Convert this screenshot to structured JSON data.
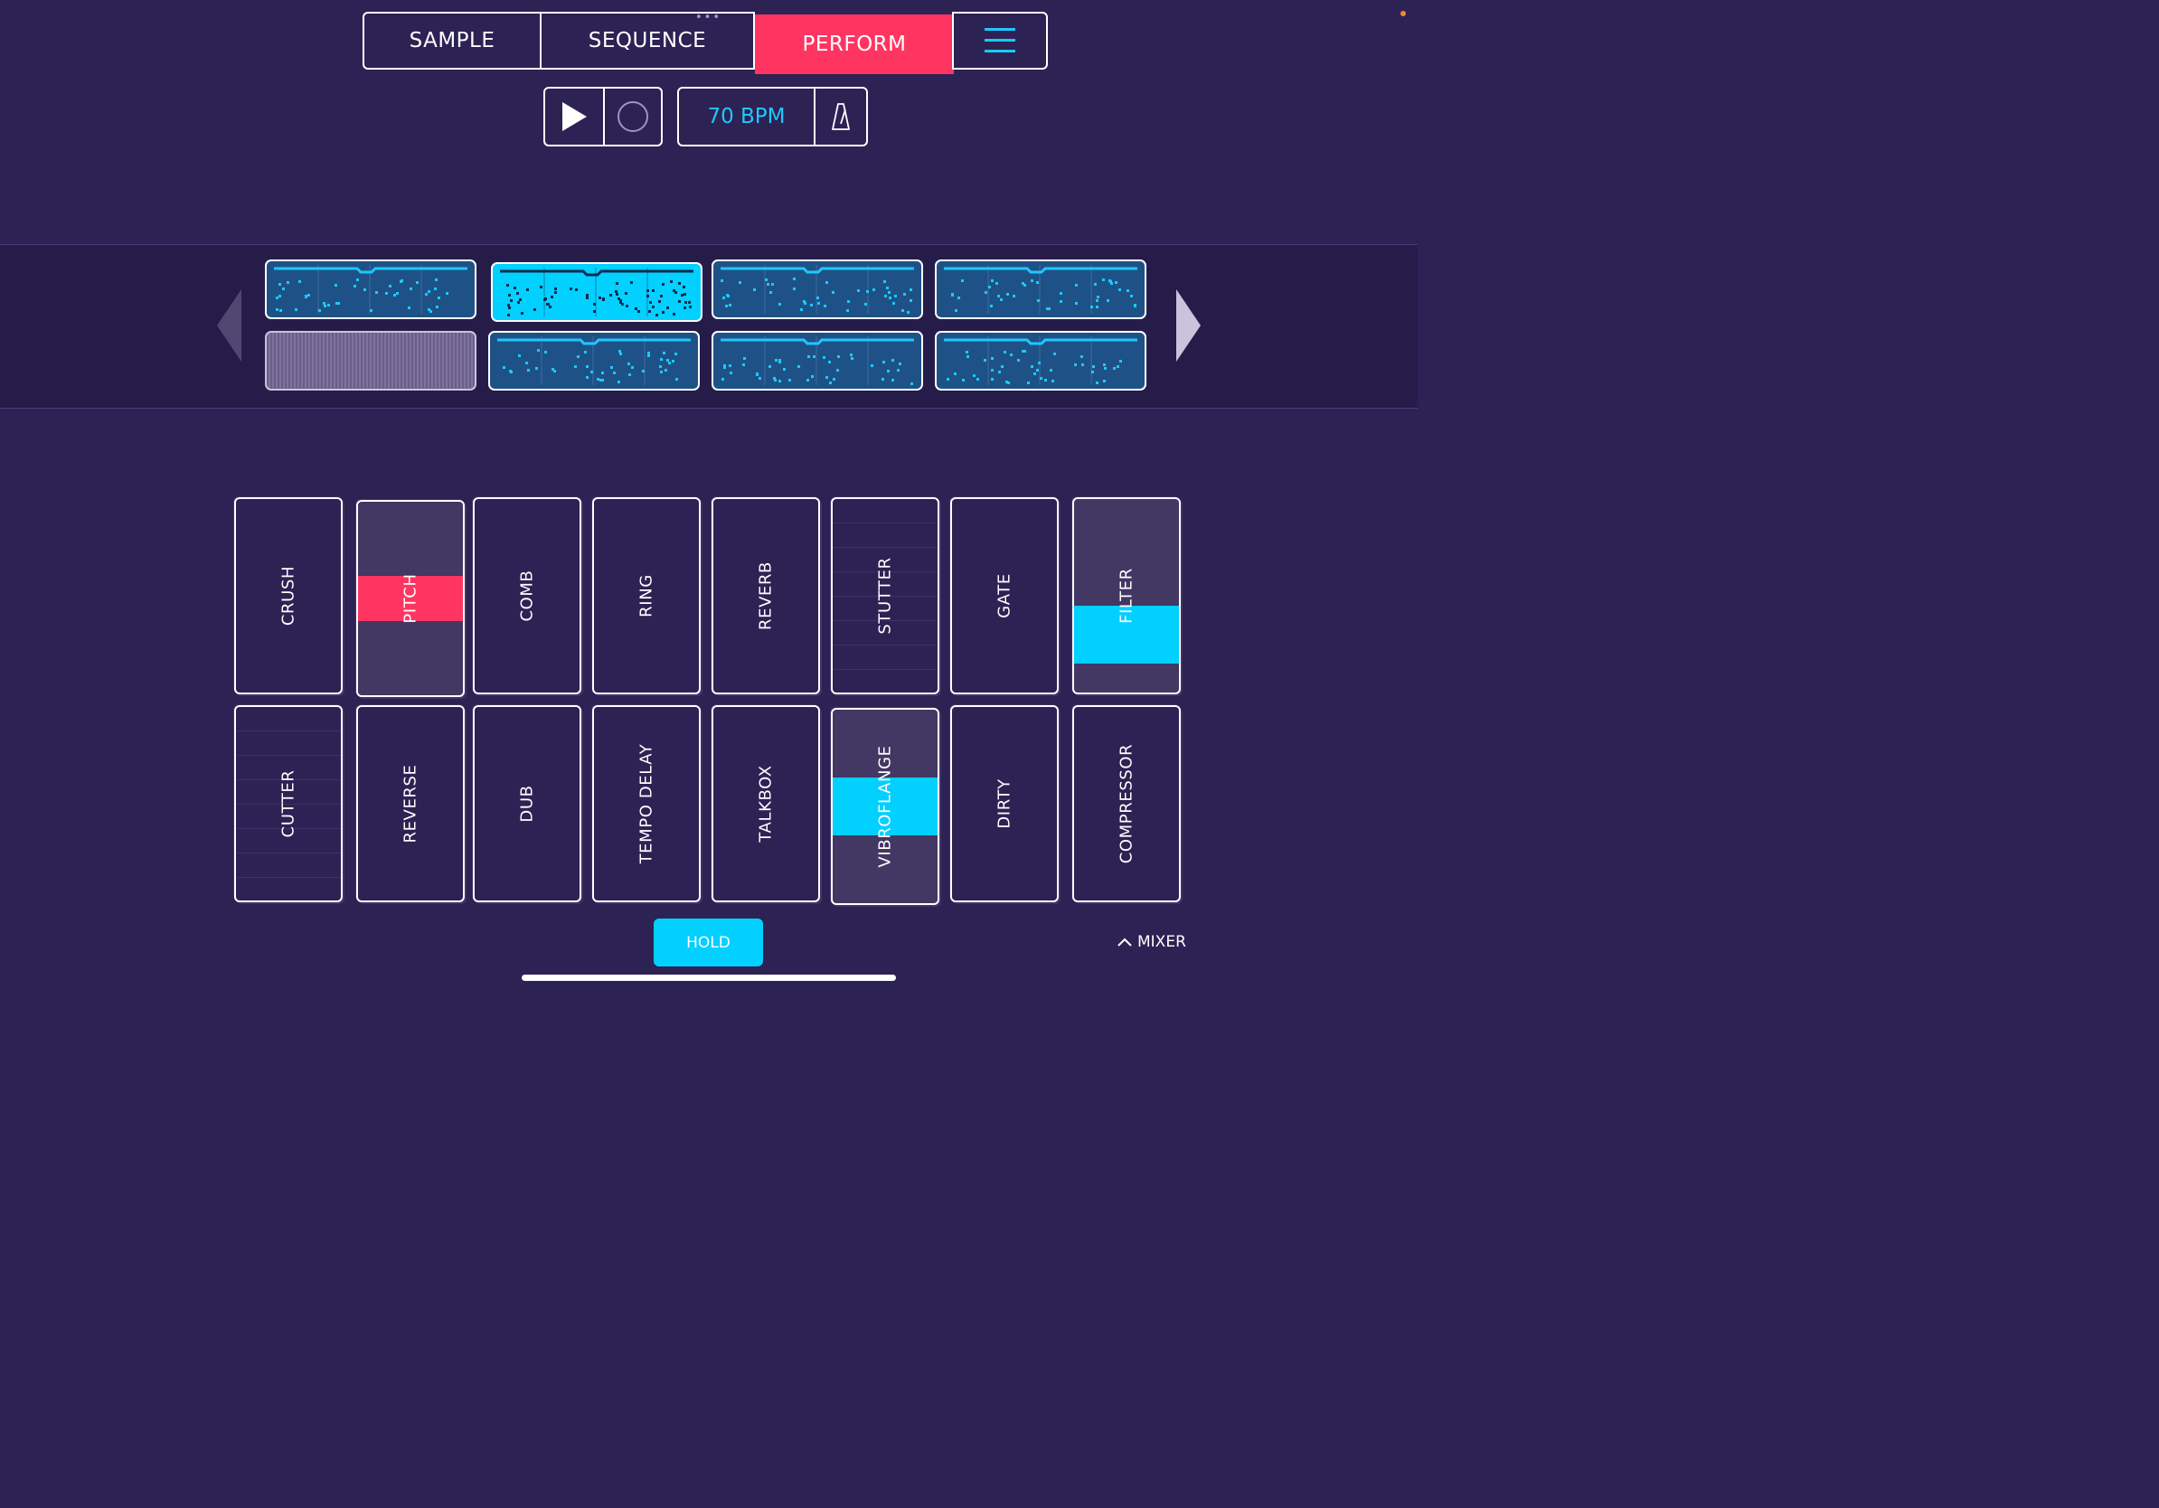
{
  "tabs": {
    "sample": "SAMPLE",
    "sequence": "SEQUENCE",
    "perform": "PERFORM"
  },
  "transport": {
    "tempo": "70 BPM"
  },
  "icons": {
    "menu": "hamburger-icon",
    "play": "play-icon",
    "record": "record-icon",
    "metronome": "metronome-icon",
    "prev": "chevron-left-icon",
    "next": "chevron-right-icon",
    "mixer": "chevron-up-icon"
  },
  "patterns": {
    "states": [
      "normal",
      "selected",
      "normal",
      "normal",
      "empty",
      "normal",
      "normal",
      "normal"
    ]
  },
  "effects": {
    "row1": [
      "CRUSH",
      "PITCH",
      "COMB",
      "RING",
      "REVERB",
      "STUTTER",
      "GATE",
      "FILTER"
    ],
    "row2": [
      "CUTTER",
      "REVERSE",
      "DUB",
      "TEMPO DELAY",
      "TALKBOX",
      "VIBROFLANGE",
      "DIRTY",
      "COMPRESSOR"
    ],
    "active": {
      "PITCH": 0.5,
      "FILTER": 0.3,
      "VIBROFLANGE": 0.5
    }
  },
  "footer": {
    "hold": "HOLD",
    "mixer": "MIXER"
  },
  "colors": {
    "background": "#2d2254",
    "accent_pink": "#ff3561",
    "accent_cyan": "#02d0ff",
    "pattern_fill": "#1e5286"
  }
}
